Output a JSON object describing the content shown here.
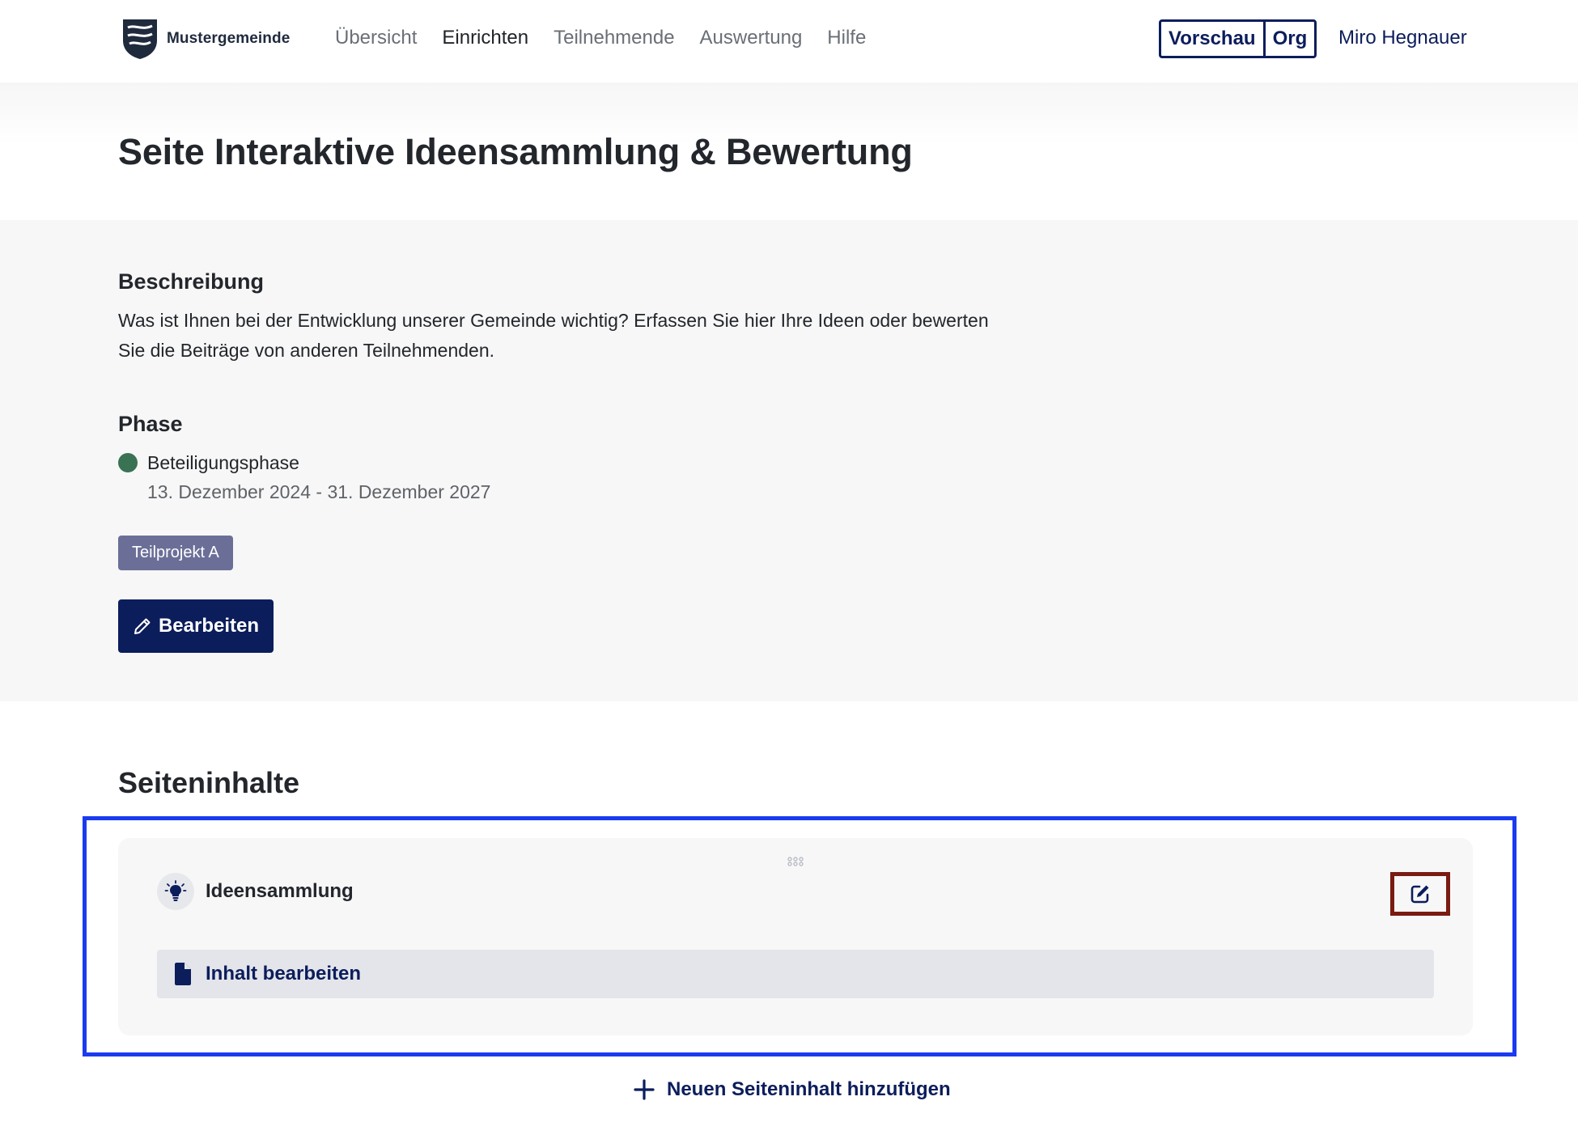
{
  "header": {
    "brand_name": "Mustergemeinde",
    "nav": [
      {
        "label": "Übersicht",
        "active": false
      },
      {
        "label": "Einrichten",
        "active": true
      },
      {
        "label": "Teilnehmende",
        "active": false
      },
      {
        "label": "Auswertung",
        "active": false
      },
      {
        "label": "Hilfe",
        "active": false
      }
    ],
    "preview_label": "Vorschau",
    "org_label": "Org",
    "user_name": "Miro Hegnauer"
  },
  "page": {
    "title": "Seite Interaktive Ideensammlung & Bewertung"
  },
  "info": {
    "description_heading": "Beschreibung",
    "description_text": "Was ist Ihnen bei der Entwicklung unserer Gemeinde wichtig? Erfassen Sie hier Ihre Ideen oder bewerten Sie die Beiträge von anderen Teilnehmenden.",
    "phase_heading": "Phase",
    "phase_name": "Beteiligungsphase",
    "phase_dates": "13. Dezember 2024 - 31. Dezember 2027",
    "tag": "Teilprojekt A",
    "edit_button": "Bearbeiten"
  },
  "contents": {
    "heading": "Seiteninhalte",
    "module_name": "Ideensammlung",
    "module_icon": "lightbulb-icon",
    "content_link": "Inhalt bearbeiten",
    "add_link": "Neuen Seiteninhalt hinzufügen"
  },
  "colors": {
    "primary": "#0c1d5c",
    "phase_active": "#3a7254",
    "tag_bg": "#6b6f98",
    "highlight_blue": "#1a3bef",
    "highlight_red": "#7a1b11"
  }
}
